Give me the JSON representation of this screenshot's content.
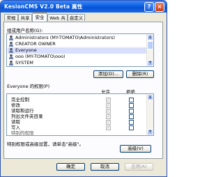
{
  "window": {
    "title": "KesionCMS V2.0 Beta 属性",
    "help_glyph": "?",
    "close_glyph": "×"
  },
  "tabs": [
    "常规",
    "共享",
    "安全",
    "Web 共享",
    "自定义"
  ],
  "active_tab": "安全",
  "users_section": {
    "label": "组或用户名称(G):",
    "items": [
      "Administrators (MY-TOMATO\\Administrators)",
      "CREATOR OWNER",
      "Everyone",
      "ooo (MY-TOMATO\\ooo)",
      "SYSTEM"
    ],
    "selected_index": 2
  },
  "buttons": {
    "add": "添加(D)...",
    "remove": "删除(R)",
    "advanced": "高级(V)",
    "ok": "确定",
    "cancel": "取消",
    "apply": "应用(A)"
  },
  "permissions": {
    "label": "Everyone 的权限(P)",
    "allow_header": "允许",
    "deny_header": "拒绝",
    "rows": [
      {
        "name": "完全控制",
        "allow": true,
        "deny": false
      },
      {
        "name": "修改",
        "allow": true,
        "deny": false
      },
      {
        "name": "读取和运行",
        "allow": true,
        "deny": false
      },
      {
        "name": "列出文件夹目录",
        "allow": true,
        "deny": false
      },
      {
        "name": "读取",
        "allow": true,
        "deny": false
      },
      {
        "name": "写入",
        "allow": true,
        "deny": false
      },
      {
        "name": "特别的权限",
        "allow": false,
        "deny": false
      }
    ]
  },
  "advanced_note": "特别权限或高级设置，请单击\"高级\"。",
  "scroll_glyphs": {
    "up": "▲",
    "down": "▼"
  },
  "check_glyph": "✓",
  "colors": {
    "titlebar": "#0a5ce0",
    "dialog_bg": "#ece9d8",
    "selection": "#d8dffd",
    "active_tab_accent": "#f3ae30"
  }
}
